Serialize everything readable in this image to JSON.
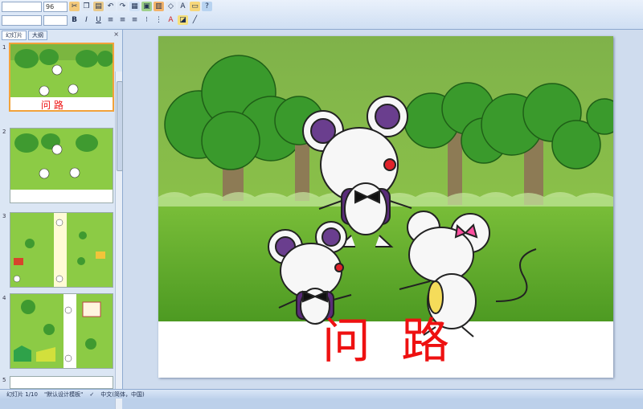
{
  "ribbon": {
    "font_size": "96",
    "row1_icons": [
      "scissors-icon",
      "copy-icon",
      "paste-icon",
      "undo-icon",
      "redo-icon",
      "table-icon",
      "picture-icon",
      "chart-icon",
      "shape-icon",
      "textbox-icon",
      "help-icon"
    ],
    "row2_icons": [
      "bold-icon",
      "italic-icon",
      "underline-icon",
      "align-left-icon",
      "align-center-icon",
      "align-right-icon",
      "bullets-icon",
      "numbering-icon",
      "font-color-icon",
      "fill-icon",
      "line-icon"
    ]
  },
  "panel": {
    "tabs": [
      "幻灯片",
      "大纲"
    ],
    "close": "×",
    "thumbnails": [
      {
        "number": "1",
        "title": "问 路"
      },
      {
        "number": "2",
        "title": ""
      },
      {
        "number": "3",
        "title": ""
      },
      {
        "number": "4",
        "title": ""
      },
      {
        "number": "5",
        "title": ""
      }
    ]
  },
  "slide": {
    "title": "问  路",
    "title_color": "#ee1111"
  },
  "statusbar": {
    "slide_counter": "幻灯片 1/10",
    "theme": "\"默认设计模板\"",
    "language": "中文(简体，中国)"
  },
  "colors": {
    "accent": "#f2a23a",
    "grass": "#8cc63e",
    "tree": "#3d9a2e"
  }
}
